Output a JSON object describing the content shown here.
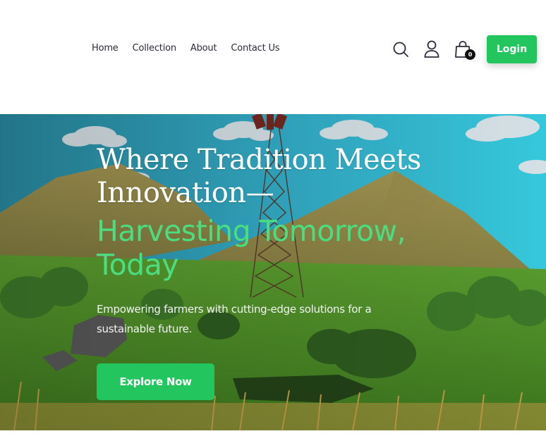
{
  "nav": {
    "links": [
      "Home",
      "Collection",
      "About",
      "Contact Us"
    ]
  },
  "header": {
    "cart_count": "0",
    "login_label": "Login"
  },
  "icons": {
    "search": "search-icon",
    "user": "user-icon",
    "cart": "shopping-bag-icon"
  },
  "hero": {
    "title_line1": "Where Tradition Meets",
    "title_line2": "Innovation—",
    "highlight_line1": "Harvesting Tomorrow,",
    "highlight_line2": "Today",
    "subtitle": "Empowering farmers with cutting-edge solutions for a sustainable future.",
    "cta_label": "Explore Now"
  },
  "colors": {
    "accent": "#22c55e",
    "highlight_text": "#4ade80",
    "nav_text": "#2b2b3a",
    "sky": "#3cb6d4"
  }
}
